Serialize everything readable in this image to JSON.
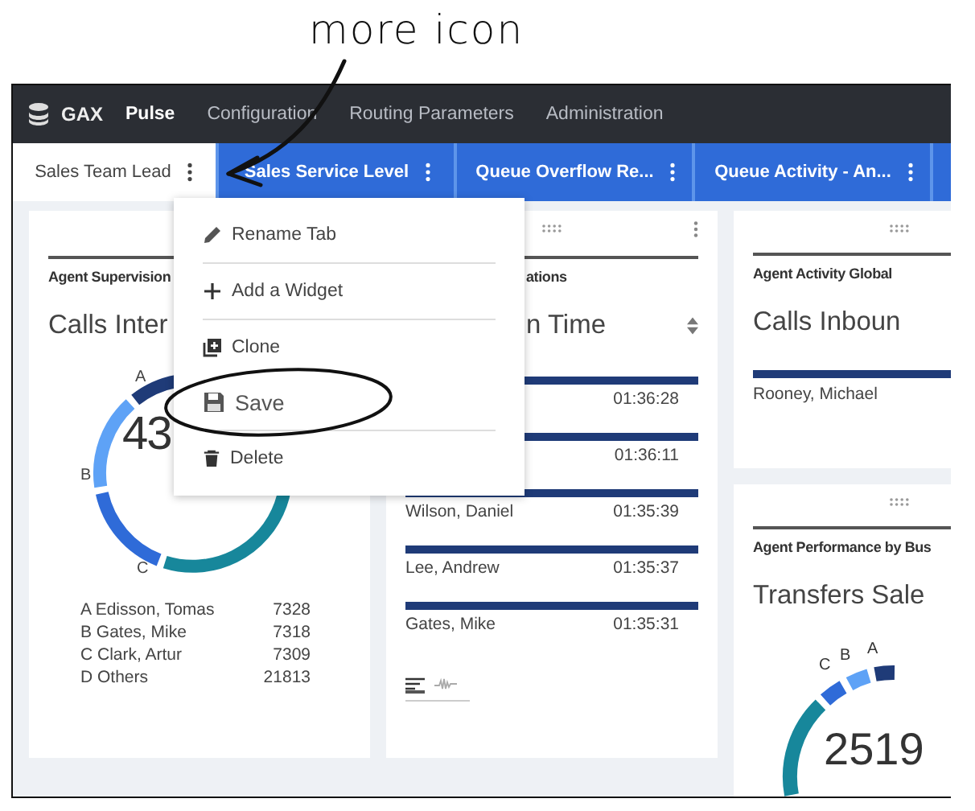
{
  "annotation": {
    "label": "more icon"
  },
  "nav": {
    "product": "GAX",
    "items": [
      {
        "label": "Pulse",
        "selected": true
      },
      {
        "label": "Configuration",
        "selected": false
      },
      {
        "label": "Routing Parameters",
        "selected": false
      },
      {
        "label": "Administration",
        "selected": false
      }
    ]
  },
  "tabs": [
    {
      "label": "Sales Team Lead",
      "selected": true
    },
    {
      "label": "Sales Service Level",
      "selected": false
    },
    {
      "label": "Queue Overflow Re...",
      "selected": false
    },
    {
      "label": "Queue Activity - An...",
      "selected": false
    }
  ],
  "tab_menu": {
    "items": [
      {
        "kind": "rename",
        "label": "Rename Tab"
      },
      {
        "kind": "add",
        "label": "Add a Widget"
      },
      {
        "kind": "clone",
        "label": "Clone"
      },
      {
        "kind": "save",
        "label": "Save"
      },
      {
        "kind": "delete",
        "label": "Delete"
      }
    ]
  },
  "widgets": [
    {
      "kind": "donut",
      "heading": "Agent Supervision",
      "title": "Calls Inter",
      "value": "43",
      "segments": [
        {
          "label": "A",
          "color": "#1f3b78"
        },
        {
          "label": "B",
          "color": "#5ea2f6"
        },
        {
          "label": "C",
          "color": "#2f6bd8"
        },
        {
          "color": "#17879b"
        }
      ],
      "legend": [
        {
          "name": "A Edisson, Tomas",
          "value": "7328"
        },
        {
          "name": "B Gates, Mike",
          "value": "7318"
        },
        {
          "name": "C Clark, Artur",
          "value": "7309"
        },
        {
          "name": "D Others",
          "value": "21813"
        }
      ]
    },
    {
      "kind": "list",
      "heading": "ations",
      "title": "n Time",
      "rows": [
        {
          "time": "01:36:28"
        },
        {
          "time": "01:36:11"
        },
        {
          "name": "Wilson, Daniel",
          "time": "01:35:39"
        },
        {
          "name": "Lee, Andrew",
          "time": "01:35:37"
        },
        {
          "name": "Gates, Mike",
          "time": "01:35:31"
        }
      ]
    },
    {
      "kind": "carousel",
      "heading": "Agent Activity Global",
      "title": "Calls Inboun",
      "rows": [
        {
          "name": "Rooney, Michael"
        }
      ]
    },
    {
      "kind": "gauge",
      "heading": "Agent Performance by Bus",
      "title": "Transfers Sale",
      "value": "2519",
      "labels": [
        "C",
        "B",
        "A"
      ]
    }
  ]
}
